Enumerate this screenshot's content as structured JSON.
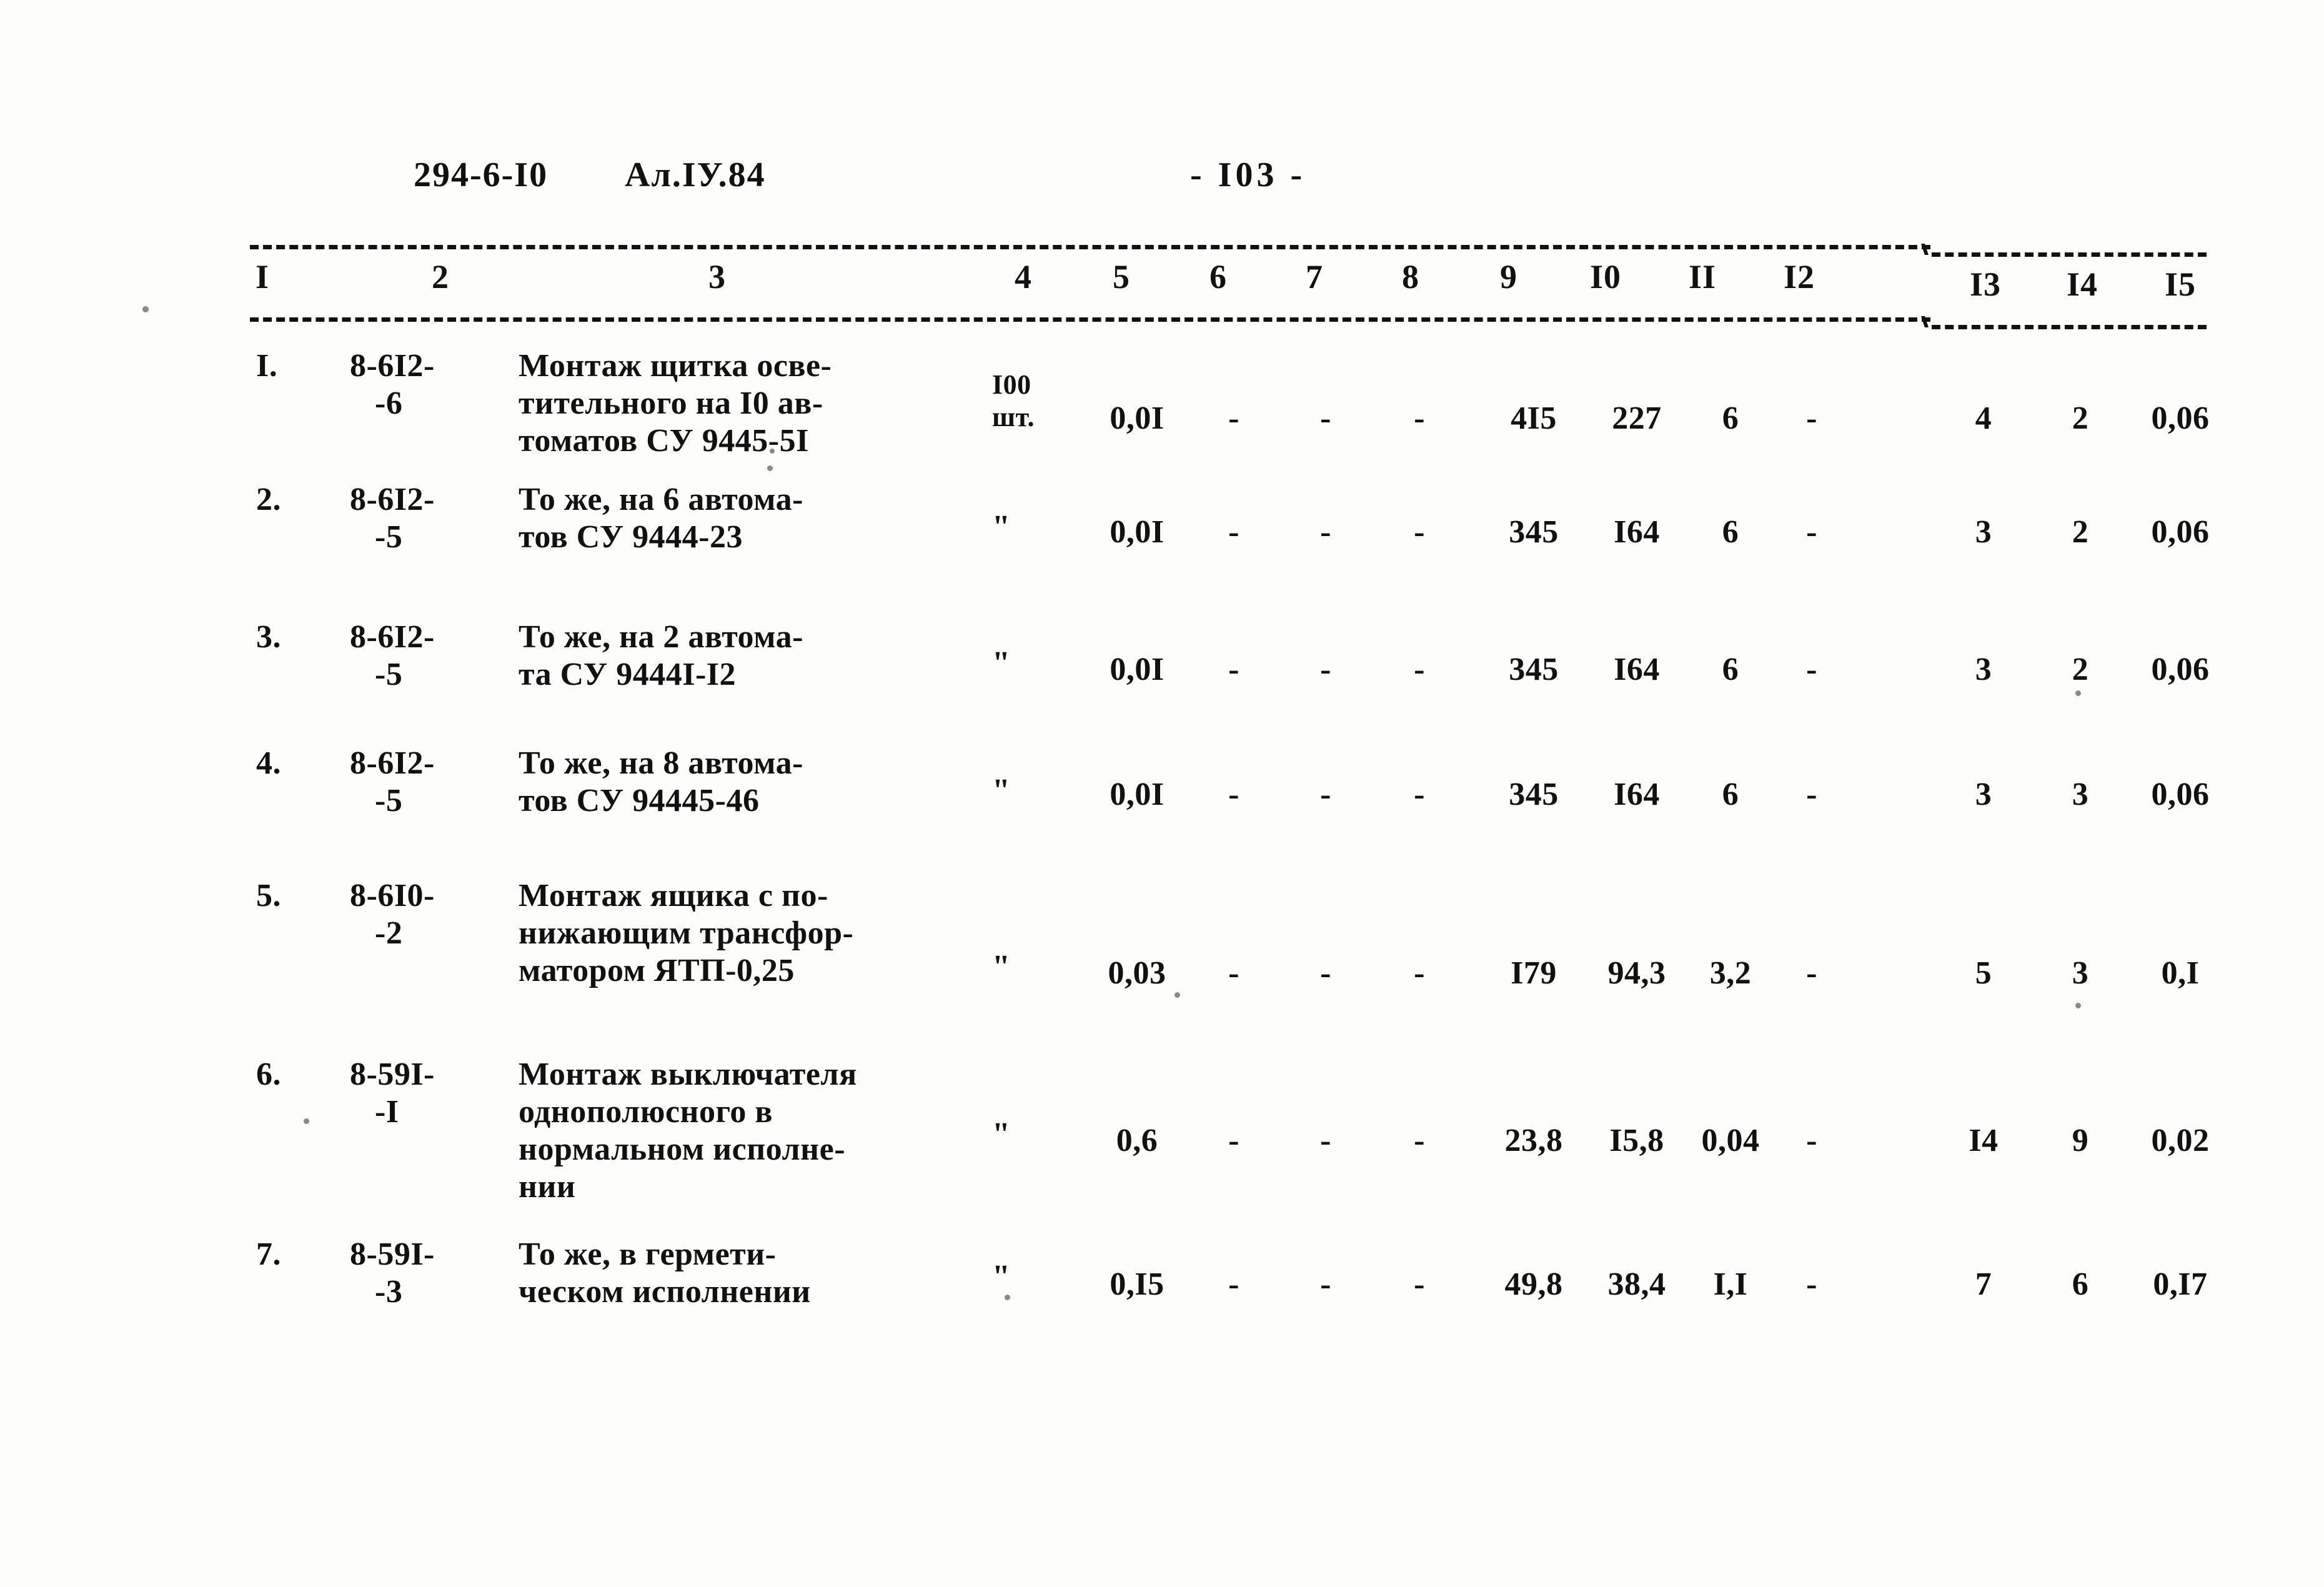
{
  "document": {
    "code": "294-6-I0",
    "album": "Ал.IУ.84",
    "page_number": "- I03 -"
  },
  "table": {
    "column_headers": [
      "I",
      "2",
      "3",
      "4",
      "5",
      "6",
      "7",
      "8",
      "9",
      "I0",
      "II",
      "I2",
      "I3",
      "I4",
      "I5"
    ],
    "rows": [
      {
        "no": "I.",
        "code_lines": [
          "8-6I2-",
          "-6"
        ],
        "desc_lines": [
          "Монтаж щитка осве-",
          "тительного на I0 ав-",
          "томатов СУ 9445-5I"
        ],
        "unit_lines": [
          "I00",
          "шт."
        ],
        "values": [
          "0,0I",
          "-",
          "-",
          "-",
          "4I5",
          "227",
          "6",
          "-",
          "4",
          "2",
          "0,06"
        ]
      },
      {
        "no": "2.",
        "code_lines": [
          "8-6I2-",
          "-5"
        ],
        "desc_lines": [
          "То же, на 6 автома-",
          "тов СУ 9444-23"
        ],
        "unit_lines": [
          "\""
        ],
        "values": [
          "0,0I",
          "-",
          "-",
          "-",
          "345",
          "I64",
          "6",
          "-",
          "3",
          "2",
          "0,06"
        ]
      },
      {
        "no": "3.",
        "code_lines": [
          "8-6I2-",
          "-5"
        ],
        "desc_lines": [
          "То же, на 2 автома-",
          "та СУ 9444I-I2"
        ],
        "unit_lines": [
          "\""
        ],
        "values": [
          "0,0I",
          "-",
          "-",
          "-",
          "345",
          "I64",
          "6",
          "-",
          "3",
          "2",
          "0,06"
        ]
      },
      {
        "no": "4.",
        "code_lines": [
          "8-6I2-",
          "-5"
        ],
        "desc_lines": [
          "То же, на 8 автома-",
          "тов СУ 94445-46"
        ],
        "unit_lines": [
          "\""
        ],
        "values": [
          "0,0I",
          "-",
          "-",
          "-",
          "345",
          "I64",
          "6",
          "-",
          "3",
          "3",
          "0,06"
        ]
      },
      {
        "no": "5.",
        "code_lines": [
          "8-6I0-",
          "-2"
        ],
        "desc_lines": [
          "Монтаж ящика с по-",
          "нижающим трансфор-",
          "матором ЯТП-0,25"
        ],
        "unit_lines": [
          "\""
        ],
        "values": [
          "0,03",
          "-",
          "-",
          "-",
          "I79",
          "94,3",
          "3,2",
          "-",
          "5",
          "3",
          "0,I"
        ]
      },
      {
        "no": "6.",
        "code_lines": [
          "8-59I-",
          "-I"
        ],
        "desc_lines": [
          "Монтаж выключателя",
          "однополюсного в",
          "нормальном исполне-",
          "нии"
        ],
        "unit_lines": [
          "\""
        ],
        "values": [
          "0,6",
          "-",
          "-",
          "-",
          "23,8",
          "I5,8",
          "0,04",
          "-",
          "I4",
          "9",
          "0,02"
        ]
      },
      {
        "no": "7.",
        "code_lines": [
          "8-59I-",
          "-3"
        ],
        "desc_lines": [
          "То же, в гермети-",
          "ческом исполнении"
        ],
        "unit_lines": [
          "\""
        ],
        "values": [
          "0,I5",
          "-",
          "-",
          "-",
          "49,8",
          "38,4",
          "I,I",
          "-",
          "7",
          "6",
          "0,I7"
        ]
      }
    ]
  },
  "layout": {
    "column_header_x": [
      420,
      705,
      1148,
      1638,
      1795,
      1950,
      2104,
      2258,
      2415,
      2570,
      2725,
      2880,
      3178,
      3333,
      3490
    ],
    "value_x": [
      1820,
      1975,
      2122,
      2272,
      2455,
      2620,
      2770,
      2900,
      3175,
      3330,
      3490
    ],
    "row_tops": [
      556,
      770,
      990,
      1192,
      1404,
      1690,
      1978
    ],
    "unit_tops": [
      590,
      818,
      1036,
      1240,
      1522,
      1790,
      2018
    ],
    "value_tops": [
      640,
      822,
      1042,
      1242,
      1528,
      1796,
      2026
    ]
  }
}
